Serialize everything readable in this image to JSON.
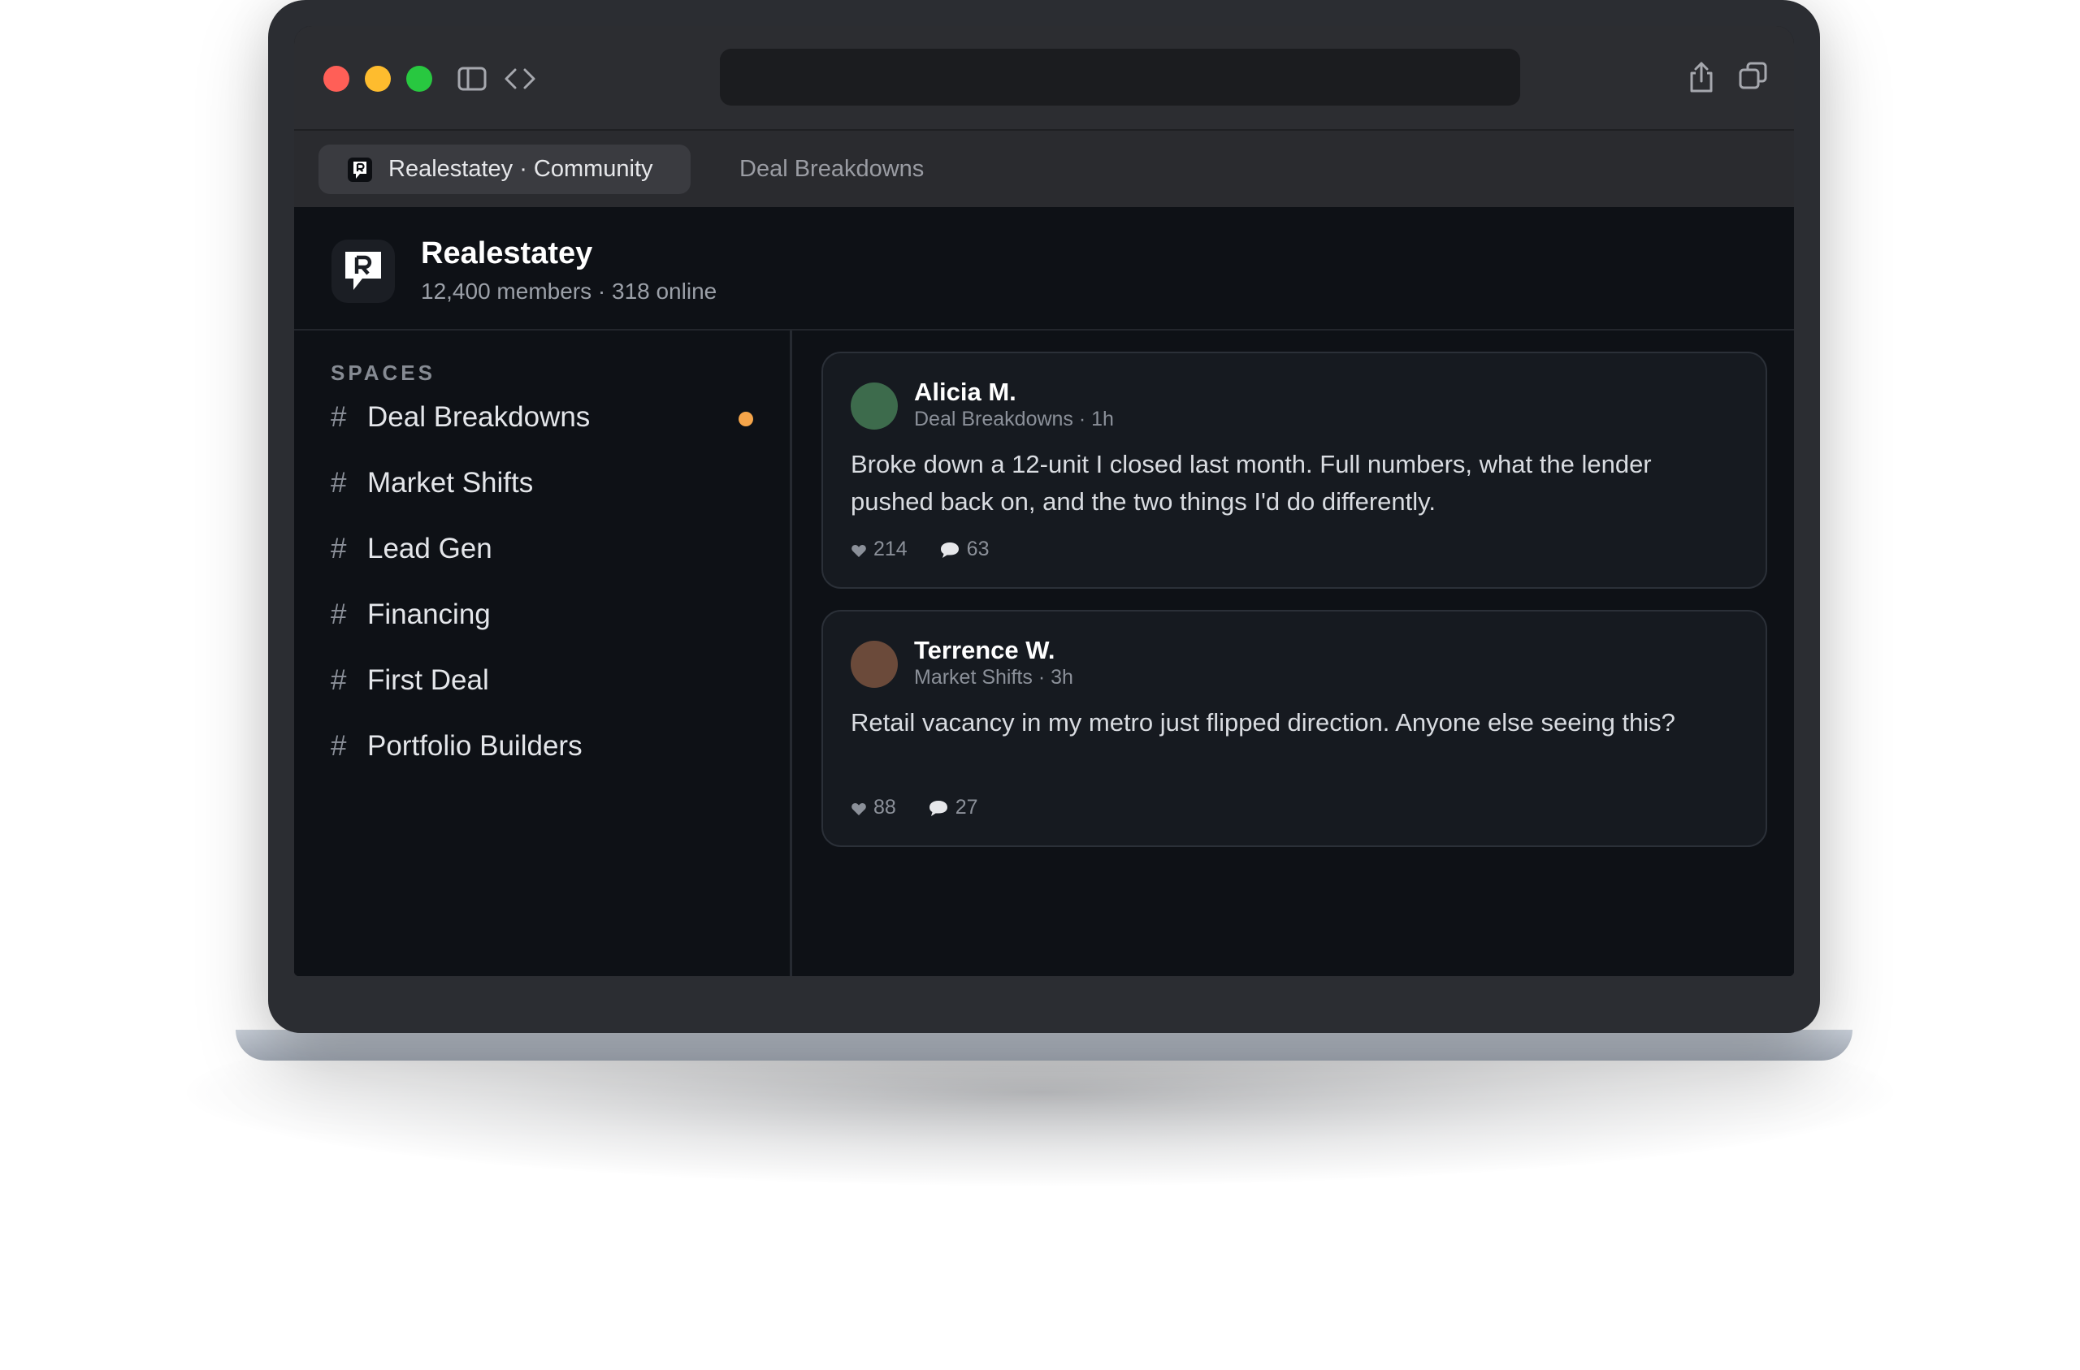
{
  "browser": {
    "tabs": [
      {
        "label": "Realestatey · Community",
        "active": true
      },
      {
        "label": "Deal Breakdowns",
        "active": false
      }
    ],
    "url": ""
  },
  "community": {
    "name": "Realestatey",
    "meta": "12,400 members · 318 online"
  },
  "sidebar": {
    "section_label": "SPACES",
    "items": [
      {
        "hash": "#",
        "label": "Deal Breakdowns",
        "unread": true
      },
      {
        "hash": "#",
        "label": "Market Shifts",
        "unread": false
      },
      {
        "hash": "#",
        "label": "Lead Gen",
        "unread": false
      },
      {
        "hash": "#",
        "label": "Financing",
        "unread": false
      },
      {
        "hash": "#",
        "label": "First Deal",
        "unread": false
      },
      {
        "hash": "#",
        "label": "Portfolio Builders",
        "unread": false
      }
    ]
  },
  "posts": [
    {
      "author": "Alicia M.",
      "meta": "Deal Breakdowns · 1h",
      "body": "Broke down a 12-unit I closed last month. Full numbers, what the lender pushed back on, and the two things I'd do differently.",
      "likes": "214",
      "comments": "63",
      "avatar_color": "#3d6b4c"
    },
    {
      "author": "Terrence W.",
      "meta": "Market Shifts · 3h",
      "body": "Retail vacancy in my metro just flipped direction. Anyone else seeing this?",
      "likes": "88",
      "comments": "27",
      "avatar_color": "#6b4a3a"
    }
  ],
  "colors": {
    "accent_unread": "#f5a54a",
    "background": "#0e1116"
  }
}
